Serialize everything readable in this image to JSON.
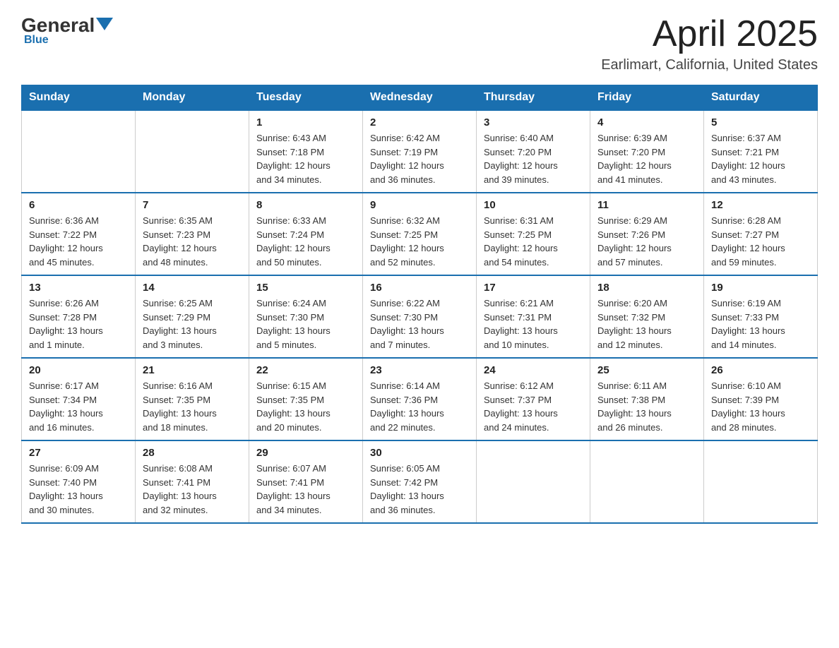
{
  "header": {
    "logo_general": "General",
    "logo_blue": "Blue",
    "month_title": "April 2025",
    "location": "Earlimart, California, United States"
  },
  "days_of_week": [
    "Sunday",
    "Monday",
    "Tuesday",
    "Wednesday",
    "Thursday",
    "Friday",
    "Saturday"
  ],
  "weeks": [
    [
      {
        "day": "",
        "info": ""
      },
      {
        "day": "",
        "info": ""
      },
      {
        "day": "1",
        "info": "Sunrise: 6:43 AM\nSunset: 7:18 PM\nDaylight: 12 hours\nand 34 minutes."
      },
      {
        "day": "2",
        "info": "Sunrise: 6:42 AM\nSunset: 7:19 PM\nDaylight: 12 hours\nand 36 minutes."
      },
      {
        "day": "3",
        "info": "Sunrise: 6:40 AM\nSunset: 7:20 PM\nDaylight: 12 hours\nand 39 minutes."
      },
      {
        "day": "4",
        "info": "Sunrise: 6:39 AM\nSunset: 7:20 PM\nDaylight: 12 hours\nand 41 minutes."
      },
      {
        "day": "5",
        "info": "Sunrise: 6:37 AM\nSunset: 7:21 PM\nDaylight: 12 hours\nand 43 minutes."
      }
    ],
    [
      {
        "day": "6",
        "info": "Sunrise: 6:36 AM\nSunset: 7:22 PM\nDaylight: 12 hours\nand 45 minutes."
      },
      {
        "day": "7",
        "info": "Sunrise: 6:35 AM\nSunset: 7:23 PM\nDaylight: 12 hours\nand 48 minutes."
      },
      {
        "day": "8",
        "info": "Sunrise: 6:33 AM\nSunset: 7:24 PM\nDaylight: 12 hours\nand 50 minutes."
      },
      {
        "day": "9",
        "info": "Sunrise: 6:32 AM\nSunset: 7:25 PM\nDaylight: 12 hours\nand 52 minutes."
      },
      {
        "day": "10",
        "info": "Sunrise: 6:31 AM\nSunset: 7:25 PM\nDaylight: 12 hours\nand 54 minutes."
      },
      {
        "day": "11",
        "info": "Sunrise: 6:29 AM\nSunset: 7:26 PM\nDaylight: 12 hours\nand 57 minutes."
      },
      {
        "day": "12",
        "info": "Sunrise: 6:28 AM\nSunset: 7:27 PM\nDaylight: 12 hours\nand 59 minutes."
      }
    ],
    [
      {
        "day": "13",
        "info": "Sunrise: 6:26 AM\nSunset: 7:28 PM\nDaylight: 13 hours\nand 1 minute."
      },
      {
        "day": "14",
        "info": "Sunrise: 6:25 AM\nSunset: 7:29 PM\nDaylight: 13 hours\nand 3 minutes."
      },
      {
        "day": "15",
        "info": "Sunrise: 6:24 AM\nSunset: 7:30 PM\nDaylight: 13 hours\nand 5 minutes."
      },
      {
        "day": "16",
        "info": "Sunrise: 6:22 AM\nSunset: 7:30 PM\nDaylight: 13 hours\nand 7 minutes."
      },
      {
        "day": "17",
        "info": "Sunrise: 6:21 AM\nSunset: 7:31 PM\nDaylight: 13 hours\nand 10 minutes."
      },
      {
        "day": "18",
        "info": "Sunrise: 6:20 AM\nSunset: 7:32 PM\nDaylight: 13 hours\nand 12 minutes."
      },
      {
        "day": "19",
        "info": "Sunrise: 6:19 AM\nSunset: 7:33 PM\nDaylight: 13 hours\nand 14 minutes."
      }
    ],
    [
      {
        "day": "20",
        "info": "Sunrise: 6:17 AM\nSunset: 7:34 PM\nDaylight: 13 hours\nand 16 minutes."
      },
      {
        "day": "21",
        "info": "Sunrise: 6:16 AM\nSunset: 7:35 PM\nDaylight: 13 hours\nand 18 minutes."
      },
      {
        "day": "22",
        "info": "Sunrise: 6:15 AM\nSunset: 7:35 PM\nDaylight: 13 hours\nand 20 minutes."
      },
      {
        "day": "23",
        "info": "Sunrise: 6:14 AM\nSunset: 7:36 PM\nDaylight: 13 hours\nand 22 minutes."
      },
      {
        "day": "24",
        "info": "Sunrise: 6:12 AM\nSunset: 7:37 PM\nDaylight: 13 hours\nand 24 minutes."
      },
      {
        "day": "25",
        "info": "Sunrise: 6:11 AM\nSunset: 7:38 PM\nDaylight: 13 hours\nand 26 minutes."
      },
      {
        "day": "26",
        "info": "Sunrise: 6:10 AM\nSunset: 7:39 PM\nDaylight: 13 hours\nand 28 minutes."
      }
    ],
    [
      {
        "day": "27",
        "info": "Sunrise: 6:09 AM\nSunset: 7:40 PM\nDaylight: 13 hours\nand 30 minutes."
      },
      {
        "day": "28",
        "info": "Sunrise: 6:08 AM\nSunset: 7:41 PM\nDaylight: 13 hours\nand 32 minutes."
      },
      {
        "day": "29",
        "info": "Sunrise: 6:07 AM\nSunset: 7:41 PM\nDaylight: 13 hours\nand 34 minutes."
      },
      {
        "day": "30",
        "info": "Sunrise: 6:05 AM\nSunset: 7:42 PM\nDaylight: 13 hours\nand 36 minutes."
      },
      {
        "day": "",
        "info": ""
      },
      {
        "day": "",
        "info": ""
      },
      {
        "day": "",
        "info": ""
      }
    ]
  ]
}
